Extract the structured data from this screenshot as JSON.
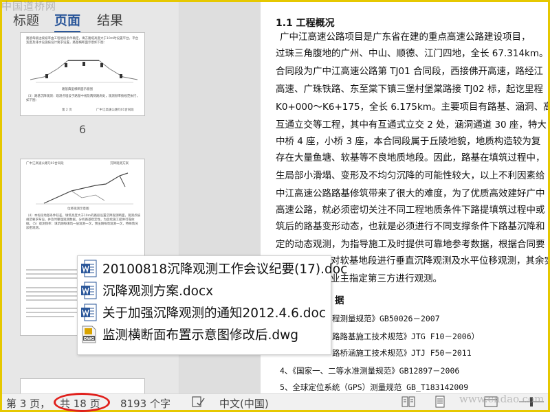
{
  "watermark_top": "中国道桥网",
  "watermark_bottom": "www.cndao.com",
  "nav": {
    "tabs": [
      {
        "label": "标题"
      },
      {
        "label": "页面"
      },
      {
        "label": "结果"
      }
    ],
    "page_number_label": "6",
    "thumb1": {
      "text_top": "路基每级边坡坡率由工程地质条件确定，填方路堤高度大于10m时设置平台，平台宽度及排水设施按设计要求设置，路基横断面示意如下图：",
      "caption": "路基典型横断面示意图",
      "text_bottom": "（3）路基沉降观测：观测点埋设于路基中线及两侧路肩处，观测频率按规范执行，如下图：",
      "footer_left": "第 2 页",
      "footer_right": "广中江高速公路TJ01合同段"
    },
    "thumb2": {
      "header_left": "广中江高速公路TJ01合同段",
      "header_right": "沉降观测方案",
      "caption": "位移观测示意图",
      "text_block": "（4）本标段地基条件较差，填筑高度大于10m的路段设置沉降观测断面，观测点按规范要求布设，并及时整理观测数据，分析路基稳定性，为后续施工提供可靠依据。（5）观测频率：填筑期每填筑一层观测一次，预压期每周观测一次，特殊情况加密观测。"
    }
  },
  "doc": {
    "heading": "1.1 工程概况",
    "lines": [
      "广中江高速公路项目是广东省在建的重点高速公路建设项目，",
      "过珠三角腹地的广州、中山、顺德、江门四地，全长 67.314km。",
      "合同段为广中江高速公路第 TJ01 合同段，西接佛开高速，路经江",
      "高速、广珠铁路、东至棠下镇三堡村堡棠路接 TJ02 标，起讫里程",
      "K0+000～K6+175，全长 6.175km。主要项目有路基、涵洞、高架桥",
      "互通立交等工程，其中有互通式立交 2 处，涵洞通道 30 座，特大",
      "中桥 4 座，小桥 3 座，本合同段属于丘陵地貌，地质构造较为复",
      "存在大量鱼塘、软基等不良地质地段。因此，路基在填筑过程中，",
      "生局部小滑塌、变形及不均匀沉降的可能性较大，以上不利因素给",
      "中江高速公路路基修筑带来了很大的难度，为了优质高效建好广中",
      "高速公路，就必须密切关注不同工程地质条件下路提填筑过程中或",
      "筑后的路基变形动态，也就是必须进行不同支撑条件下路基沉降和",
      "定的动态观测，为指导施工及时提供可靠地参考数据，根据合同要",
      "对软基地段进行垂直沉降观测及水平位移观测，其余实",
      "业主指定第三方进行观测。",
      "据",
      "程测量规范》GB50026－2007",
      "路路基施工技术规范》JTG F10－2006）",
      "路桥涵施工技术规范》JTJ F50－2011",
      "4、《国家一、二等水准测量规范》GB12897－2006",
      "5、全球定位系统（GPS）测量规范 GB_T183142009"
    ]
  },
  "recent_files": [
    {
      "name": "20100818沉降观测工作会议纪要(17).doc",
      "icon": "word-icon"
    },
    {
      "name": "沉降观测方案.docx",
      "icon": "word-icon"
    },
    {
      "name": "关于加强沉降观测的通知2012.4.6.doc",
      "icon": "word-icon"
    },
    {
      "name": "监测横断面布置示意图修改后.dwg",
      "icon": "dwg-icon"
    }
  ],
  "dwg_icon_label": "DWG",
  "status": {
    "page": "第 3 页，",
    "total_pages": "共 18 页",
    "word_count": "8193 个字",
    "language": "中文(中国)"
  },
  "colors": {
    "frame": "#e6c800",
    "accent": "#2b579a",
    "word_icon": "#2b579a",
    "annotation": "#e0201c"
  }
}
